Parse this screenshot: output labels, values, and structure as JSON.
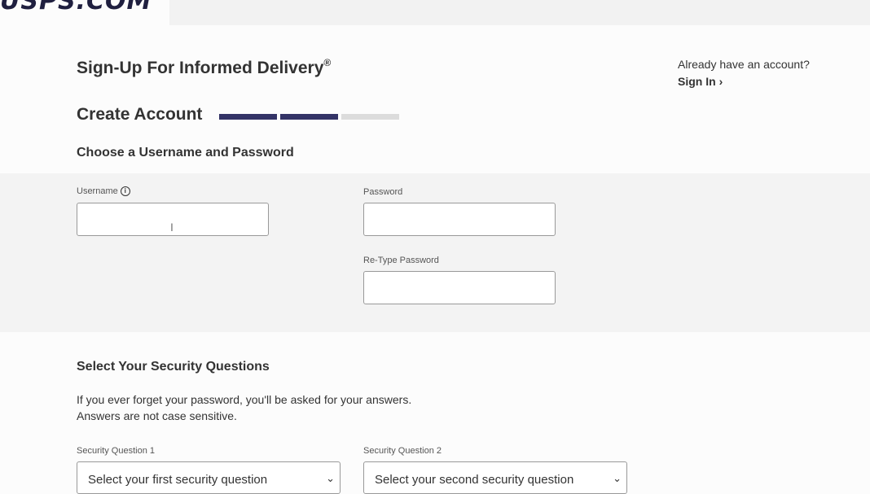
{
  "header": {
    "logo_text": "USPS.COM"
  },
  "page": {
    "title": "Sign-Up For Informed Delivery",
    "title_mark": "®",
    "signin_prompt": "Already have an account?",
    "signin_link": "Sign In",
    "signin_chevron": "›"
  },
  "step": {
    "title": "Create Account",
    "progress_total": 3,
    "progress_done": 2
  },
  "credentials": {
    "title": "Choose a Username and Password",
    "username_label": "Username",
    "username_info_icon": "ⓘ",
    "password_label": "Password",
    "retype_label": "Re-Type Password"
  },
  "security": {
    "title": "Select Your Security Questions",
    "help_line1": "If you ever forget your password, you'll be asked for your answers.",
    "help_line2": "Answers are not case sensitive.",
    "q1_label": "Security Question 1",
    "q1_selected": "Select your first security question",
    "q2_label": "Security Question 2",
    "q2_selected": "Select your second security question"
  }
}
